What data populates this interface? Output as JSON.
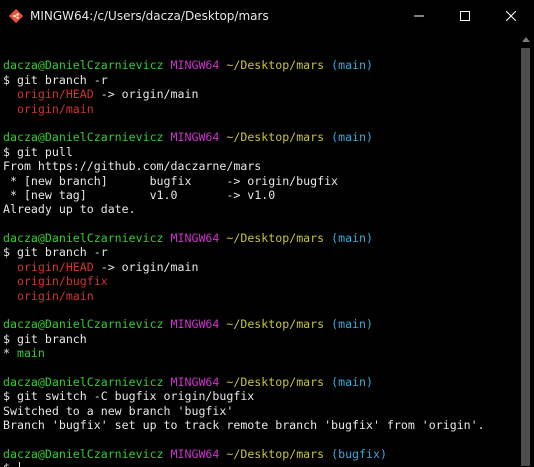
{
  "window": {
    "title": "MINGW64:/c/Users/dacza/Desktop/mars",
    "icon": "git-bash-icon"
  },
  "colors": {
    "background": "#000000",
    "text": "#e6e6e6",
    "user": "#33cc33",
    "host": "#cc33cc",
    "path": "#c7c43d",
    "branch": "#3aa9d8",
    "remote": "#d0342c",
    "local": "#33cc33"
  },
  "terminal": {
    "lines": [
      [],
      [
        {
          "t": "dacza@DanielCzarnievicz",
          "c": "user"
        },
        {
          "t": " "
        },
        {
          "t": "MINGW64",
          "c": "host"
        },
        {
          "t": " "
        },
        {
          "t": "~/Desktop/mars",
          "c": "path"
        },
        {
          "t": " "
        },
        {
          "t": "(main)",
          "c": "branch"
        }
      ],
      [
        {
          "t": "$ git branch -r"
        }
      ],
      [
        {
          "t": "  "
        },
        {
          "t": "origin/HEAD",
          "c": "remote"
        },
        {
          "t": " -> origin/main"
        }
      ],
      [
        {
          "t": "  "
        },
        {
          "t": "origin/main",
          "c": "remote"
        }
      ],
      [],
      [
        {
          "t": "dacza@DanielCzarnievicz",
          "c": "user"
        },
        {
          "t": " "
        },
        {
          "t": "MINGW64",
          "c": "host"
        },
        {
          "t": " "
        },
        {
          "t": "~/Desktop/mars",
          "c": "path"
        },
        {
          "t": " "
        },
        {
          "t": "(main)",
          "c": "branch"
        }
      ],
      [
        {
          "t": "$ git pull"
        }
      ],
      [
        {
          "t": "From https://github.com/daczarne/mars"
        }
      ],
      [
        {
          "t": " * [new branch]      bugfix     -> origin/bugfix"
        }
      ],
      [
        {
          "t": " * [new tag]         v1.0       -> v1.0"
        }
      ],
      [
        {
          "t": "Already up to date."
        }
      ],
      [],
      [
        {
          "t": "dacza@DanielCzarnievicz",
          "c": "user"
        },
        {
          "t": " "
        },
        {
          "t": "MINGW64",
          "c": "host"
        },
        {
          "t": " "
        },
        {
          "t": "~/Desktop/mars",
          "c": "path"
        },
        {
          "t": " "
        },
        {
          "t": "(main)",
          "c": "branch"
        }
      ],
      [
        {
          "t": "$ git branch -r"
        }
      ],
      [
        {
          "t": "  "
        },
        {
          "t": "origin/HEAD",
          "c": "remote"
        },
        {
          "t": " -> origin/main"
        }
      ],
      [
        {
          "t": "  "
        },
        {
          "t": "origin/bugfix",
          "c": "remote"
        }
      ],
      [
        {
          "t": "  "
        },
        {
          "t": "origin/main",
          "c": "remote"
        }
      ],
      [],
      [
        {
          "t": "dacza@DanielCzarnievicz",
          "c": "user"
        },
        {
          "t": " "
        },
        {
          "t": "MINGW64",
          "c": "host"
        },
        {
          "t": " "
        },
        {
          "t": "~/Desktop/mars",
          "c": "path"
        },
        {
          "t": " "
        },
        {
          "t": "(main)",
          "c": "branch"
        }
      ],
      [
        {
          "t": "$ git branch"
        }
      ],
      [
        {
          "t": "* "
        },
        {
          "t": "main",
          "c": "local"
        }
      ],
      [],
      [
        {
          "t": "dacza@DanielCzarnievicz",
          "c": "user"
        },
        {
          "t": " "
        },
        {
          "t": "MINGW64",
          "c": "host"
        },
        {
          "t": " "
        },
        {
          "t": "~/Desktop/mars",
          "c": "path"
        },
        {
          "t": " "
        },
        {
          "t": "(main)",
          "c": "branch"
        }
      ],
      [
        {
          "t": "$ git switch -C bugfix origin/bugfix"
        }
      ],
      [
        {
          "t": "Switched to a new branch 'bugfix'"
        }
      ],
      [
        {
          "t": "Branch 'bugfix' set up to track remote branch 'bugfix' from 'origin'."
        }
      ],
      [],
      [
        {
          "t": "dacza@DanielCzarnievicz",
          "c": "user"
        },
        {
          "t": " "
        },
        {
          "t": "MINGW64",
          "c": "host"
        },
        {
          "t": " "
        },
        {
          "t": "~/Desktop/mars",
          "c": "path"
        },
        {
          "t": " "
        },
        {
          "t": "(bugfix)",
          "c": "branch"
        }
      ],
      [
        {
          "t": "$ ",
          "cursor": true
        }
      ]
    ]
  }
}
